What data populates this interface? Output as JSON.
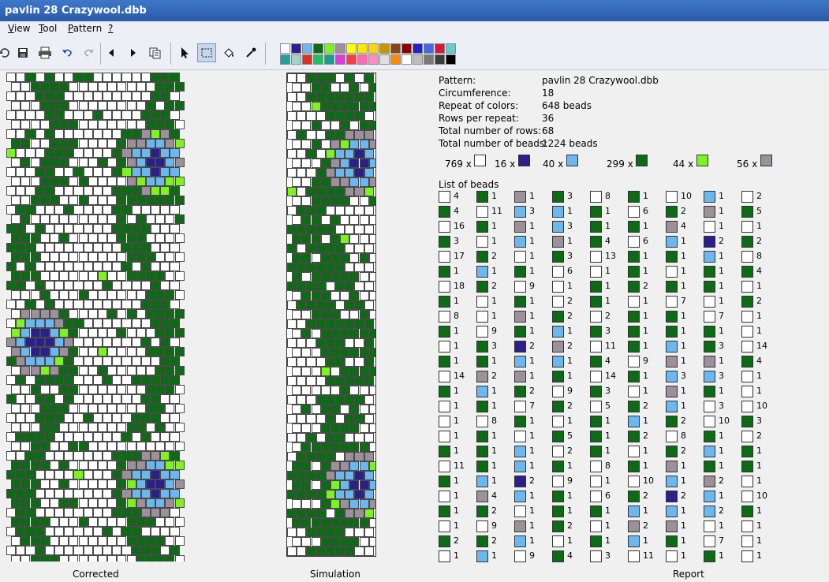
{
  "window": {
    "title": "pavlin 28 Crazywool.dbb"
  },
  "menu": [
    {
      "label": "View",
      "key": "V"
    },
    {
      "label": "Tool",
      "key": "T"
    },
    {
      "label": "Pattern",
      "key": "P"
    },
    {
      "label": "?",
      "key": "?"
    }
  ],
  "toolbar": {
    "buttons": [
      "open-icon",
      "save-icon",
      "print-icon",
      "undo-icon",
      "redo-icon",
      "arrow-left-icon",
      "arrow-right-icon",
      "copy-icon",
      "pointer-icon",
      "select-rect-icon",
      "fill-icon",
      "eyedropper-icon"
    ],
    "active": [
      "select-rect-icon"
    ]
  },
  "palette": {
    "row1": [
      "#ffffff",
      "#2a1f8c",
      "#6bb8f0",
      "#0c6b14",
      "#7cf51f",
      "#9c909a",
      "#ffff00",
      "#ffe600",
      "#ffd700",
      "#c89600",
      "#8b4513",
      "#8b0000",
      "#2222cc",
      "#4169e1",
      "#dc143c",
      "#66cccc"
    ],
    "row2": [
      "#22a0a0",
      "#a8d0c8",
      "#e03020",
      "#20c060",
      "#10a090",
      "#dc3cdc",
      "#ff3c3c",
      "#ff69b4",
      "#ff8cc8",
      "#e0e0e0",
      "#ff8c00",
      "#ffffff",
      "#bcbcbc",
      "#7a7a7a",
      "#3c3c3c",
      "#000000"
    ]
  },
  "colors": {
    "white": "#ffffff",
    "navy": "#2a1f8c",
    "lightblue": "#6bb8f0",
    "green": "#0c6b14",
    "lime": "#7cf51f",
    "mauve": "#9c909a"
  },
  "panels": {
    "corrected_label": "Corrected",
    "simulation_label": "Simulation",
    "report_label": "Report"
  },
  "report": {
    "pattern_label": "Pattern:",
    "pattern_value": "pavlin 28 Crazywool.dbb",
    "circumference_label": "Circumference:",
    "circumference_value": "18",
    "repeat_colors_label": "Repeat of colors:",
    "repeat_colors_value": "648 beads",
    "rows_per_repeat_label": "Rows per repeat:",
    "rows_per_repeat_value": "36",
    "total_rows_label": "Total number of rows:",
    "total_rows_value": "68",
    "total_beads_label": "Total number of beads:",
    "total_beads_value": "1224 beads",
    "color_counts": [
      {
        "count": "769 x",
        "color": "white"
      },
      {
        "count": "16 x",
        "color": "navy"
      },
      {
        "count": "40 x",
        "color": "lightblue"
      },
      {
        "count": "299 x",
        "color": "green"
      },
      {
        "count": "44 x",
        "color": "lime"
      },
      {
        "count": "56 x",
        "color": "mauve"
      }
    ],
    "list_label": "List of beads",
    "bead_list": [
      [
        "W4",
        "G4",
        "W16",
        "G3",
        "W17",
        "G1",
        "W18",
        "G1",
        "W8",
        "G1",
        "W1",
        "G1",
        "W14",
        "G1",
        "W1",
        "W1",
        "W1",
        "G1",
        "W11",
        "G1",
        "W1",
        "G1",
        "W1",
        "G2",
        "W1"
      ],
      [
        "G1",
        "W11",
        "G1",
        "W1",
        "G2",
        "L1",
        "G2",
        "W1",
        "W1",
        "W9",
        "G3",
        "G1",
        "M2",
        "L1",
        "G1",
        "W8",
        "G1",
        "G1",
        "G1",
        "L1",
        "M4",
        "G2",
        "W9",
        "G2",
        "L1"
      ],
      [
        "M1",
        "L3",
        "M1",
        "L1",
        "W1",
        "G1",
        "W9",
        "G1",
        "M1",
        "G1",
        "N2",
        "L1",
        "M1",
        "G2",
        "W7",
        "G1",
        "W1",
        "L1",
        "L1",
        "N2",
        "L1",
        "W1",
        "M1",
        "L1",
        "W9"
      ],
      [
        "G3",
        "L1",
        "L3",
        "M1",
        "G3",
        "W6",
        "W1",
        "W2",
        "G2",
        "L1",
        "M2",
        "L1",
        "G1",
        "W9",
        "G2",
        "W1",
        "G5",
        "W2",
        "G1",
        "W9",
        "G1",
        "G1",
        "G2",
        "W1",
        "G4"
      ],
      [
        "W8",
        "G1",
        "G1",
        "G4",
        "W13",
        "W1",
        "G1",
        "G1",
        "W2",
        "G3",
        "W11",
        "G4",
        "W14",
        "G3",
        "W5",
        "G1",
        "G1",
        "G1",
        "W8",
        "W1",
        "W6",
        "G1",
        "W1",
        "G1",
        "W3"
      ],
      [
        "G1",
        "W6",
        "G1",
        "W6",
        "G1",
        "G1",
        "G2",
        "W1",
        "G1",
        "G1",
        "G1",
        "W9",
        "G1",
        "W1",
        "G2",
        "L1",
        "G2",
        "W1",
        "G1",
        "W10",
        "G2",
        "L1",
        "M2",
        "L1",
        "W11"
      ],
      [
        "W10",
        "G2",
        "M4",
        "L1",
        "G1",
        "W1",
        "G1",
        "W7",
        "G1",
        "G1",
        "L1",
        "M1",
        "L3",
        "M1",
        "L1",
        "G2",
        "W8",
        "G2",
        "M1",
        "L1",
        "N2",
        "L1",
        "M1",
        "G1",
        "W1"
      ],
      [
        "L1",
        "M1",
        "W1",
        "N2",
        "L1",
        "G1",
        "G1",
        "W1",
        "W7",
        "G1",
        "G3",
        "M1",
        "L3",
        "G1",
        "W3",
        "W10",
        "G1",
        "L1",
        "G1",
        "M2",
        "L1",
        "L2",
        "W1",
        "W7",
        "G1"
      ],
      [
        "W2",
        "G5",
        "W1",
        "G2",
        "W8",
        "G4",
        "W1",
        "G2",
        "W1",
        "W1",
        "W14",
        "G4",
        "W1",
        "W1",
        "W10",
        "G3",
        "W2",
        "G1",
        "G1",
        "W1",
        "W10",
        "G1",
        "W1",
        "W1",
        "W1"
      ]
    ]
  }
}
